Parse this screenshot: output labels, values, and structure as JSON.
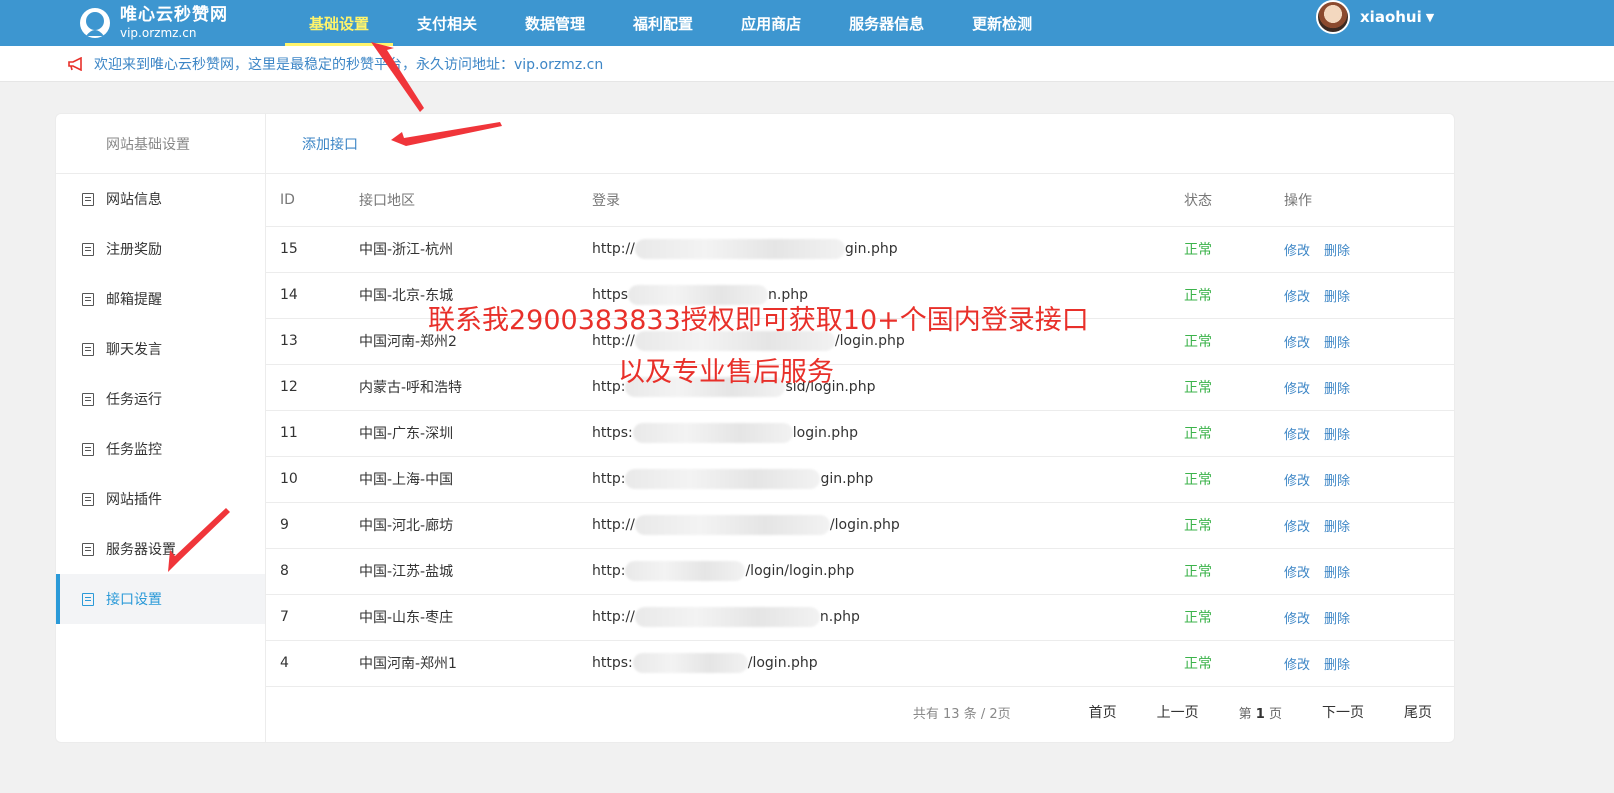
{
  "brand": {
    "title": "唯心云秒赞网",
    "subtitle": "vip.orzmz.cn"
  },
  "nav": [
    {
      "label": "基础设置",
      "active": true
    },
    {
      "label": "支付相关"
    },
    {
      "label": "数据管理"
    },
    {
      "label": "福利配置"
    },
    {
      "label": "应用商店"
    },
    {
      "label": "服务器信息"
    },
    {
      "label": "更新检测"
    }
  ],
  "user": {
    "name": "xiaohui"
  },
  "notice": "欢迎来到唯心云秒赞网，这里是最稳定的秒赞平台，永久访问地址：vip.orzmz.cn",
  "sidebar": {
    "heading": "网站基础设置",
    "items": [
      {
        "label": "网站信息"
      },
      {
        "label": "注册奖励"
      },
      {
        "label": "邮箱提醒"
      },
      {
        "label": "聊天发言"
      },
      {
        "label": "任务运行"
      },
      {
        "label": "任务监控"
      },
      {
        "label": "网站插件"
      },
      {
        "label": "服务器设置"
      },
      {
        "label": "接口设置",
        "active": true
      }
    ]
  },
  "main": {
    "add_label": "添加接口",
    "columns": [
      "ID",
      "接口地区",
      "登录",
      "状态",
      "操作"
    ],
    "rows": [
      {
        "id": "15",
        "area": "中国-浙江-杭州",
        "login_prefix": "http://",
        "login_suffix": "gin.php",
        "status": "正常"
      },
      {
        "id": "14",
        "area": "中国-北京-东城",
        "login_prefix": "https",
        "login_suffix": "n.php",
        "status": "正常"
      },
      {
        "id": "13",
        "area": "中国河南-郑州2",
        "login_prefix": "http://",
        "login_suffix": "/login.php",
        "status": "正常"
      },
      {
        "id": "12",
        "area": "内蒙古-呼和浩特",
        "login_prefix": "http:",
        "login_suffix": "sid/login.php",
        "status": "正常"
      },
      {
        "id": "11",
        "area": "中国-广东-深圳",
        "login_prefix": "https:",
        "login_suffix": "login.php",
        "status": "正常"
      },
      {
        "id": "10",
        "area": "中国-上海-中国",
        "login_prefix": "http:",
        "login_suffix": "gin.php",
        "status": "正常"
      },
      {
        "id": "9",
        "area": "中国-河北-廊坊",
        "login_prefix": "http://",
        "login_suffix": "/login.php",
        "status": "正常"
      },
      {
        "id": "8",
        "area": "中国-江苏-盐城",
        "login_prefix": "http:",
        "login_suffix": "/login/login.php",
        "status": "正常"
      },
      {
        "id": "7",
        "area": "中国-山东-枣庄",
        "login_prefix": "http://",
        "login_suffix": "n.php",
        "status": "正常"
      },
      {
        "id": "4",
        "area": "中国河南-郑州1",
        "login_prefix": "https:",
        "login_suffix": "/login.php",
        "status": "正常"
      }
    ],
    "edit_label": "修改",
    "delete_label": "删除"
  },
  "pager": {
    "total": "共有 13 条 / 2页",
    "first": "首页",
    "prev": "上一页",
    "current_prefix": "第",
    "current": "1",
    "current_suffix": "页",
    "next": "下一页",
    "last": "尾页"
  },
  "overlay": {
    "line1": "联系我2900383833授权即可获取10+个国内登录接口",
    "line2": "以及专业售后服务"
  },
  "colors": {
    "topbar": "#3d96d0",
    "nav_active": "#fff46b",
    "link": "#3d86c6",
    "status_ok": "#3cb34b",
    "overlay_text": "#e8302a",
    "arrow": "#f0353a"
  }
}
